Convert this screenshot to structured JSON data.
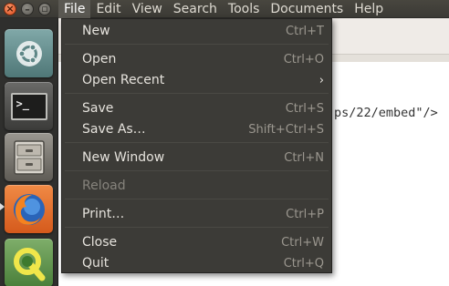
{
  "window_controls": {
    "close_glyph": "×",
    "minimize_glyph": "–",
    "maximize_glyph": "▫"
  },
  "menubar": {
    "items": [
      "File",
      "Edit",
      "View",
      "Search",
      "Tools",
      "Documents",
      "Help"
    ],
    "active": "File"
  },
  "launcher": {
    "items": [
      "ubuntu-dash-icon",
      "terminal-icon",
      "file-cabinet-icon",
      "firefox-icon",
      "qgis-icon"
    ],
    "terminal_prompt": ">_"
  },
  "editor": {
    "visible_line": "ps/22/embed\"/>"
  },
  "file_menu": {
    "items": [
      {
        "label": "New",
        "accel": "Ctrl+T"
      },
      {
        "label": "Open",
        "accel": "Ctrl+O"
      },
      {
        "label": "Open Recent",
        "accel": "›"
      },
      {
        "label": "Save",
        "accel": "Ctrl+S"
      },
      {
        "label": "Save As…",
        "accel": "Shift+Ctrl+S"
      },
      {
        "label": "New Window",
        "accel": "Ctrl+N"
      },
      {
        "label": "Reload",
        "accel": ""
      },
      {
        "label": "Print…",
        "accel": "Ctrl+P"
      },
      {
        "label": "Close",
        "accel": "Ctrl+W"
      },
      {
        "label": "Quit",
        "accel": "Ctrl+Q"
      }
    ]
  },
  "colors": {
    "menubar_bg": "#3c3b37",
    "menu_bg": "#3c3b37",
    "accent_close": "#e0491a"
  }
}
